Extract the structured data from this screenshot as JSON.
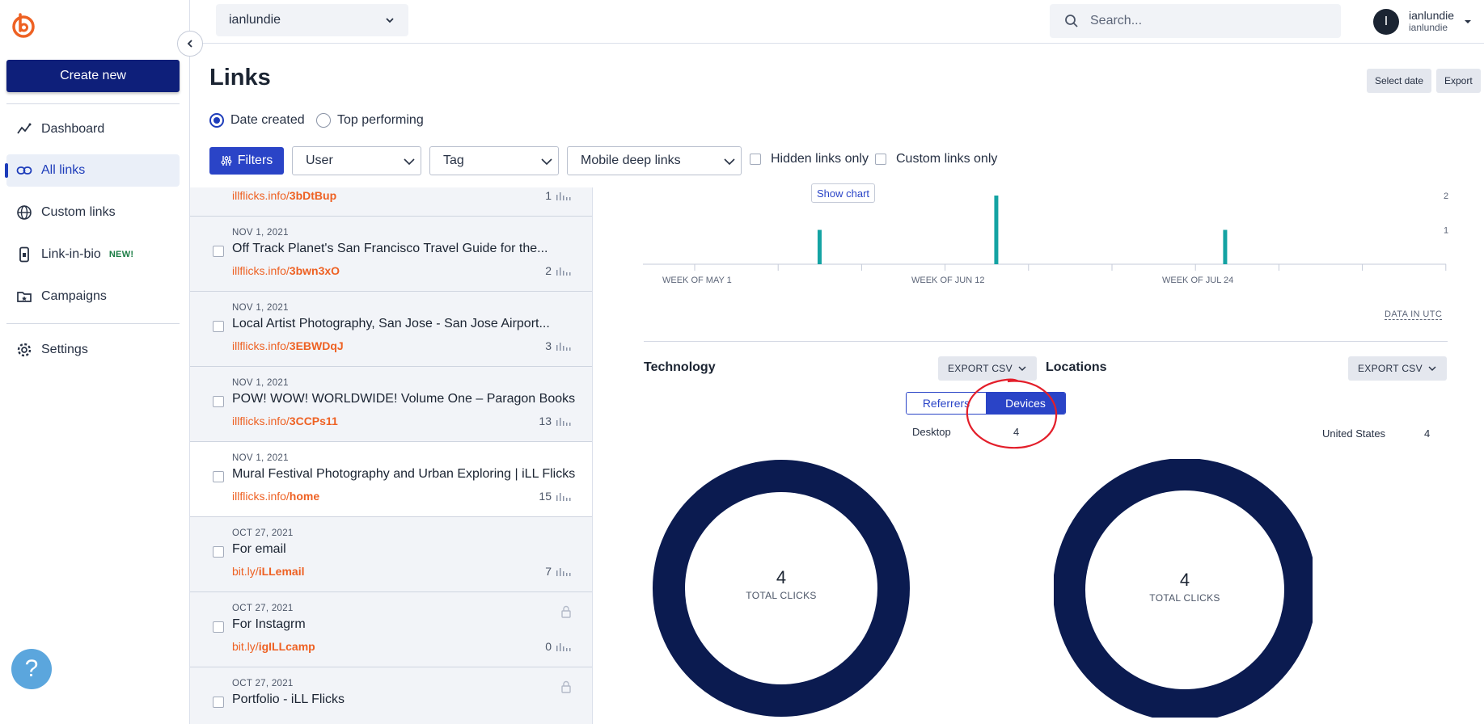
{
  "sidebar": {
    "create_new": "Create new",
    "items": [
      {
        "label": "Dashboard",
        "icon": "dashboard-icon"
      },
      {
        "label": "All links",
        "icon": "link-icon"
      },
      {
        "label": "Custom links",
        "icon": "globe-icon"
      },
      {
        "label": "Link-in-bio",
        "icon": "phone-icon",
        "badge": "NEW!"
      },
      {
        "label": "Campaigns",
        "icon": "folder-star-icon"
      },
      {
        "label": "Settings",
        "icon": "gear-icon"
      }
    ],
    "help": "?"
  },
  "topbar": {
    "account": "ianlundie",
    "search_placeholder": "Search...",
    "avatar_letter": "I",
    "user_name": "ianlundie",
    "user_sub": "ianlundie"
  },
  "page": {
    "title": "Links",
    "select_date": "Select date",
    "export": "Export",
    "sort_date_created": "Date created",
    "sort_top_performing": "Top performing"
  },
  "filters": {
    "filters_label": "Filters",
    "user": "User",
    "tag": "Tag",
    "mobile_deep_links": "Mobile deep links",
    "hidden_only": "Hidden links only",
    "custom_only": "Custom links only"
  },
  "links": [
    {
      "date": "",
      "title": "",
      "domain": "illflicks.info/",
      "slug": "3bDtBup",
      "clicks": "1"
    },
    {
      "date": "NOV 1, 2021",
      "title": "Off Track Planet's San Francisco Travel Guide for the...",
      "domain": "illflicks.info/",
      "slug": "3bwn3xO",
      "clicks": "2"
    },
    {
      "date": "NOV 1, 2021",
      "title": "Local Artist Photography, San Jose - San Jose Airport...",
      "domain": "illflicks.info/",
      "slug": "3EBWDqJ",
      "clicks": "3"
    },
    {
      "date": "NOV 1, 2021",
      "title": "POW! WOW! WORLDWIDE! Volume One – Paragon Books",
      "domain": "illflicks.info/",
      "slug": "3CCPs11",
      "clicks": "13"
    },
    {
      "date": "NOV 1, 2021",
      "title": "Mural Festival Photography and Urban Exploring | iLL Flicks",
      "domain": "illflicks.info/",
      "slug": "home",
      "clicks": "15"
    },
    {
      "date": "OCT 27, 2021",
      "title": "For email",
      "domain": "bit.ly/",
      "slug": "iLLemail",
      "clicks": "7"
    },
    {
      "date": "OCT 27, 2021",
      "title": "For Instagrm",
      "domain": "bit.ly/",
      "slug": "igILLcamp",
      "clicks": "0"
    },
    {
      "date": "OCT 27, 2021",
      "title": "Portfolio - iLL Flicks",
      "domain": "",
      "slug": "",
      "clicks": ""
    }
  ],
  "analytics": {
    "show_chart": "Show chart",
    "data_in_utc": "DATA IN UTC",
    "technology": "Technology",
    "locations": "Locations",
    "export_csv": "EXPORT CSV",
    "toggle_referrers": "Referrers",
    "toggle_devices": "Devices",
    "devices": [
      {
        "label": "Desktop",
        "value": "4"
      }
    ],
    "locations_list": [
      {
        "label": "United States",
        "value": "4"
      }
    ],
    "total_clicks_label": "TOTAL CLICKS",
    "tech_total": "4",
    "loc_total": "4",
    "donut_color": "#0b1b50",
    "accent": "#2a44c7",
    "brand_orange": "#ee6123"
  },
  "chart_data": {
    "type": "bar",
    "x_tick_labels": [
      "WEEK OF MAY 1",
      "WEEK OF JUN 12",
      "WEEK OF JUL 24"
    ],
    "y_tick_labels": [
      "2",
      "1"
    ],
    "ylim": [
      0,
      2
    ],
    "bars": [
      {
        "x_index": 0.22,
        "value": 1
      },
      {
        "x_index": 0.44,
        "value": 2
      },
      {
        "x_index": 0.725,
        "value": 1
      }
    ],
    "color": "#14a3a3"
  }
}
